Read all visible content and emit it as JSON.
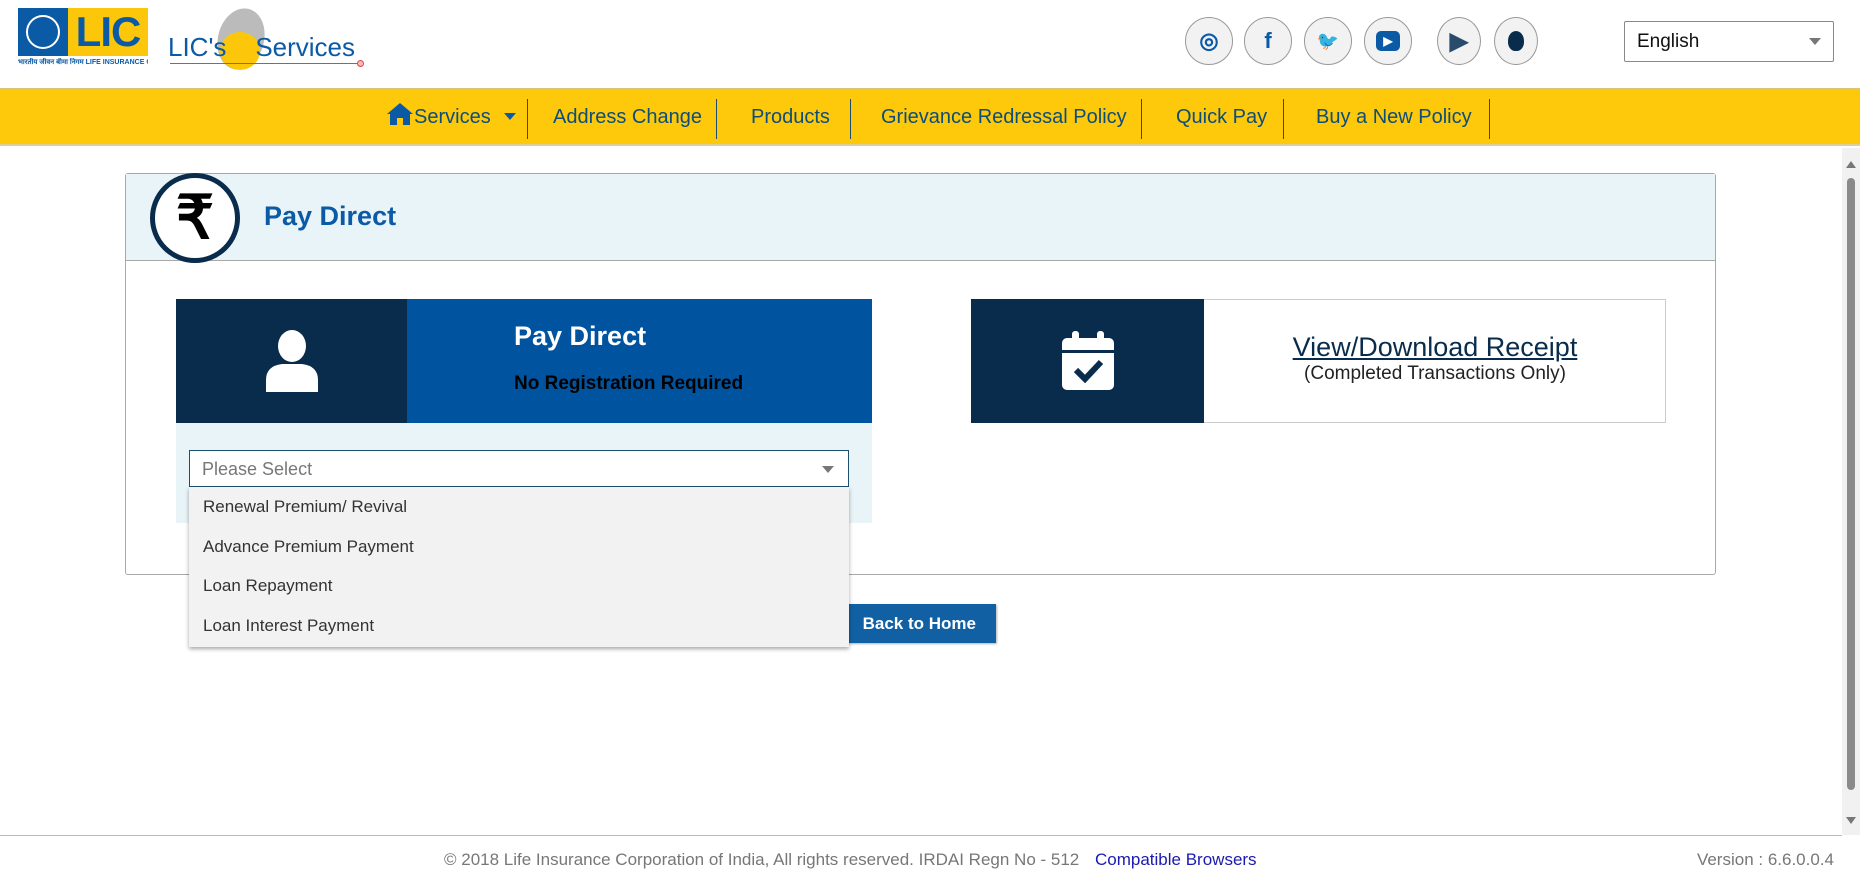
{
  "header": {
    "logo_text": "LIC",
    "logo_subtext": "भारतीय जीवन बीमा निगम LIFE INSURANCE CORPORATION OF INDIA",
    "eservices_logo": "LIC's eServices",
    "social": [
      {
        "icon": "instagram-icon",
        "glyph": "◎"
      },
      {
        "icon": "facebook-icon",
        "glyph": "f"
      },
      {
        "icon": "twitter-icon",
        "glyph": "🐦"
      },
      {
        "icon": "youtube-icon",
        "glyph": "▶"
      },
      {
        "icon": "play-store-icon",
        "glyph": "▶"
      },
      {
        "icon": "apple-icon",
        "glyph": ""
      }
    ],
    "language": "English"
  },
  "nav": {
    "items": [
      "Services",
      "Address Change",
      "Products",
      "Grievance Redressal Policy",
      "Quick Pay",
      "Buy a New Policy"
    ]
  },
  "panel": {
    "title": "Pay Direct",
    "rupee_glyph": "₹",
    "left_card": {
      "title": "Pay Direct",
      "subtitle": "No Registration Required"
    },
    "right_card": {
      "link": "View/Download Receipt",
      "subtitle": "(Completed Transactions Only)"
    },
    "select": {
      "placeholder": "Please Select",
      "options": [
        "Renewal Premium/ Revival",
        "Advance Premium Payment",
        "Loan Repayment",
        "Loan Interest Payment"
      ]
    }
  },
  "back_button": "Back to Home",
  "footer": {
    "copyright": "© 2018 Life Insurance Corporation of India, All rights reserved. IRDAI Regn No - 512",
    "compatible": "Compatible Browsers",
    "version": "Version : 6.6.0.0.4"
  },
  "colors": {
    "nav_bg": "#fdc90a",
    "brand_blue": "#0b5aa6",
    "dark_navy": "#0a2c4c"
  }
}
